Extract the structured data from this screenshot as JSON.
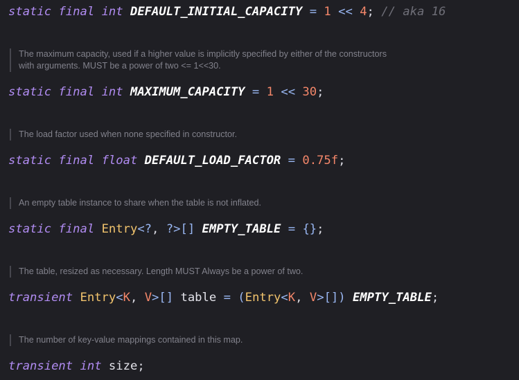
{
  "colors": {
    "background": "#1f1f24",
    "keyword": "#b18cf2",
    "constant": "#ffffff",
    "type": "#f2c46d",
    "number": "#f4876a",
    "operator": "#9ab8f4",
    "comment": "#6f6f78",
    "doc_text": "#82828c"
  },
  "code": {
    "l1": {
      "kw1": "static",
      "kw2": "final",
      "kw3": "int",
      "name": "DEFAULT_INITIAL_CAPACITY",
      "eq": "=",
      "n1": "1",
      "shift": "<<",
      "n2": "4",
      "semi": ";",
      "comment": "// aka 16"
    },
    "d1": {
      "line1": "The maximum capacity, used if a higher value is implicitly specified by either of the constructors",
      "line2": "with arguments. MUST be a power of two <= 1<<30."
    },
    "l2": {
      "kw1": "static",
      "kw2": "final",
      "kw3": "int",
      "name": "MAXIMUM_CAPACITY",
      "eq": "=",
      "n1": "1",
      "shift": "<<",
      "n2": "30",
      "semi": ";"
    },
    "d2": {
      "line1": "The load factor used when none specified in constructor."
    },
    "l3": {
      "kw1": "static",
      "kw2": "final",
      "kw3": "float",
      "name": "DEFAULT_LOAD_FACTOR",
      "eq": "=",
      "val": "0.75f",
      "semi": ";"
    },
    "d3": {
      "line1": "An empty table instance to share when the table is not inflated."
    },
    "l4": {
      "kw1": "static",
      "kw2": "final",
      "type": "Entry",
      "lt": "<",
      "g1": "?",
      "comma": ",",
      "g2": "?",
      "gt": ">",
      "arr": "[]",
      "name": "EMPTY_TABLE",
      "eq": "=",
      "val": "{}",
      "semi": ";"
    },
    "d4": {
      "line1": "The table, resized as necessary. Length MUST Always be a power of two."
    },
    "l5": {
      "kw1": "transient",
      "type": "Entry",
      "lt": "<",
      "g1": "K",
      "comma": ",",
      "g2": "V",
      "gt": ">",
      "arr": "[]",
      "name": "table",
      "eq": "=",
      "po": "(",
      "type2": "Entry",
      "lt2": "<",
      "g3": "K",
      "comma2": ",",
      "g4": "V",
      "gt2": ">",
      "arr2": "[]",
      "pc": ")",
      "const": "EMPTY_TABLE",
      "semi": ";"
    },
    "d5": {
      "line1": "The number of key-value mappings contained in this map."
    },
    "l6": {
      "kw1": "transient",
      "kw2": "int",
      "name": "size",
      "semi": ";"
    }
  }
}
